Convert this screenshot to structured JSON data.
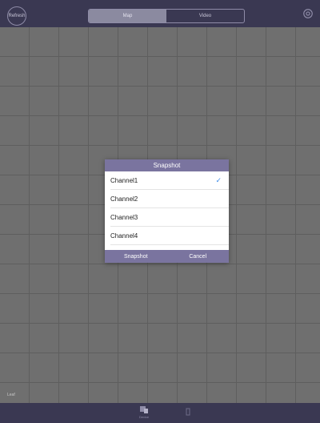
{
  "header": {
    "refresh_label": "Refresh",
    "tabs": [
      {
        "label": "Map",
        "active": true
      },
      {
        "label": "Video",
        "active": false
      }
    ],
    "settings_icon": "gear-icon"
  },
  "map": {
    "caption": "Leaf"
  },
  "dialog": {
    "title": "Snapshot",
    "channels": [
      {
        "label": "Channel1",
        "selected": true
      },
      {
        "label": "Channel2",
        "selected": false
      },
      {
        "label": "Channel3",
        "selected": false
      },
      {
        "label": "Channel4",
        "selected": false
      }
    ],
    "check_glyph": "✓",
    "buttons": {
      "confirm": "Snapshot",
      "cancel": "Cancel"
    }
  },
  "bottom_tabs": [
    {
      "label": "Device",
      "icon": "device-icon"
    },
    {
      "label": "",
      "icon": "info-icon"
    }
  ],
  "colors": {
    "bar": "#3a3852",
    "dialog_accent": "#7a749f",
    "check": "#3e8ce9"
  }
}
